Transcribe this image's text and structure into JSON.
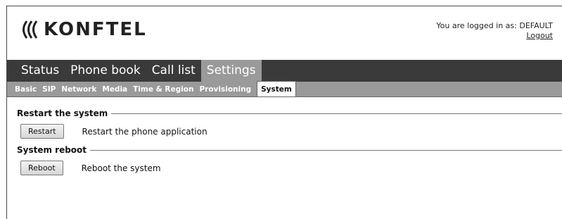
{
  "header": {
    "logo_text": "KONFTEL",
    "login_text": "You are logged in as: DEFAULT",
    "logout_label": "Logout"
  },
  "main_nav": {
    "tabs": [
      {
        "label": "Status"
      },
      {
        "label": "Phone book"
      },
      {
        "label": "Call list"
      },
      {
        "label": "Settings",
        "active": true
      }
    ]
  },
  "sub_nav": {
    "tabs": [
      {
        "label": "Basic"
      },
      {
        "label": "SIP"
      },
      {
        "label": "Network"
      },
      {
        "label": "Media"
      },
      {
        "label": "Time & Region"
      },
      {
        "label": "Provisioning"
      },
      {
        "label": "System",
        "active": true
      }
    ]
  },
  "sections": [
    {
      "title": "Restart the system",
      "button_label": "Restart",
      "description": "Restart the phone application"
    },
    {
      "title": "System reboot",
      "button_label": "Reboot",
      "description": "Reboot the system"
    }
  ],
  "colors": {
    "nav_dark": "#3a3a3a",
    "nav_active": "#9a9a9a"
  }
}
